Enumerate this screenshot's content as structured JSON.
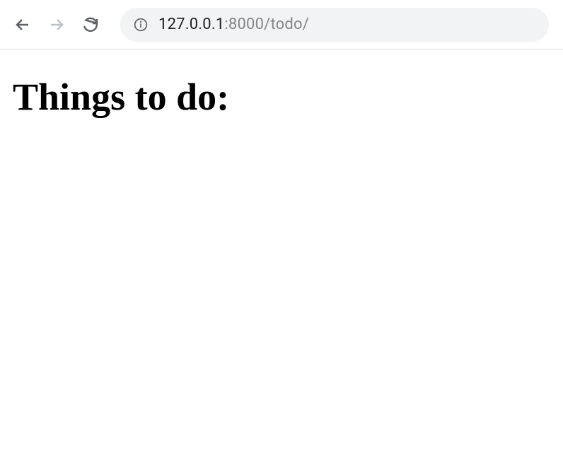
{
  "browser": {
    "url_host": "127.0.0.1",
    "url_path": ":8000/todo/"
  },
  "page": {
    "heading": "Things to do:"
  }
}
